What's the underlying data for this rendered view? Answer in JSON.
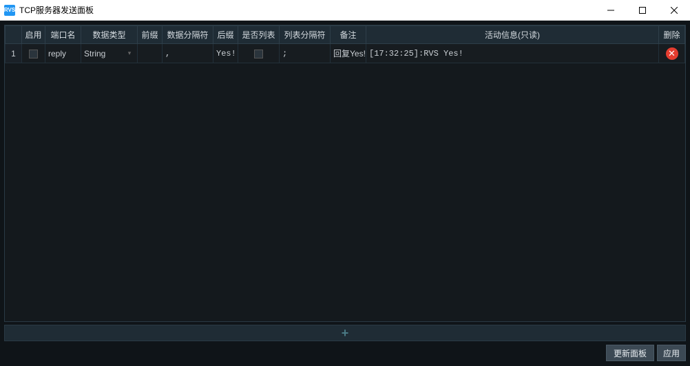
{
  "window": {
    "app_icon_text": "RVS",
    "title": "TCP服务器发送面板"
  },
  "columns": {
    "row_index": "",
    "enable": "启用",
    "port_name": "端口名",
    "data_type": "数据类型",
    "prefix": "前缀",
    "data_separator": "数据分隔符",
    "suffix": "后缀",
    "is_list": "是否列表",
    "list_separator": "列表分隔符",
    "remark": "备注",
    "activity_info": "活动信息(只读)",
    "delete": "删除"
  },
  "rows": [
    {
      "index": "1",
      "enable_checked": false,
      "port_name": "reply",
      "data_type": "String",
      "prefix": "",
      "data_separator": ",",
      "suffix": "Yes!",
      "is_list_checked": false,
      "list_separator": ";",
      "remark": "回复Yes!",
      "activity_info": "[17:32:25]:RVS Yes!"
    }
  ],
  "add_row_symbol": "+",
  "buttons": {
    "refresh_panel": "更新面板",
    "apply": "应用"
  }
}
